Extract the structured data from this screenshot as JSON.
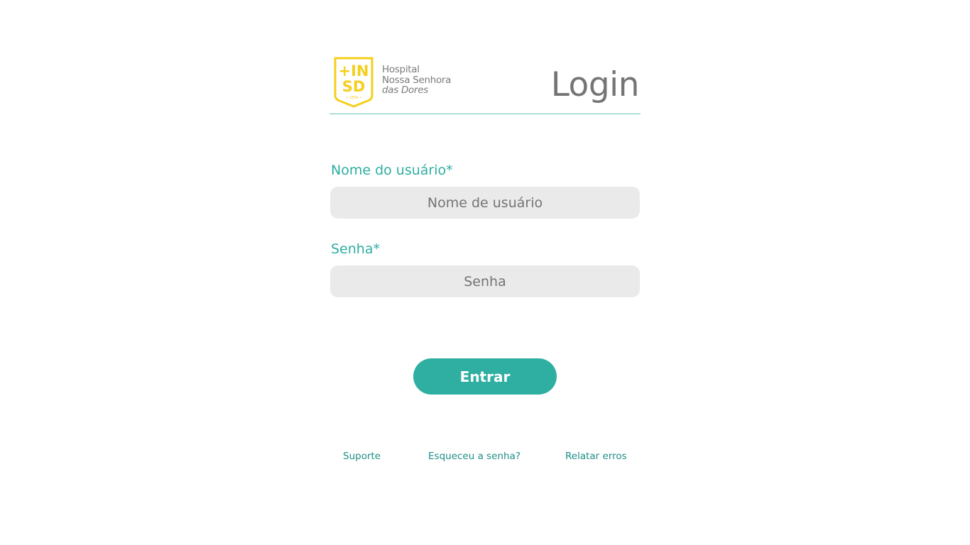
{
  "header": {
    "logo": {
      "monogram_top": "+INSD",
      "monogram_line1": "+IN",
      "monogram_line2": "SD",
      "year": "• 1859 •",
      "name_line1": "Hospital",
      "name_line2": "Nossa Senhora",
      "name_line3": "das Dores",
      "color": "#f5cf1e"
    },
    "title": "Login",
    "divider_color": "#6cc3bb"
  },
  "form": {
    "username": {
      "label": "Nome do usuário*",
      "placeholder": "Nome de usuário",
      "value": ""
    },
    "password": {
      "label": "Senha*",
      "placeholder": "Senha",
      "value": ""
    },
    "submit_label": "Entrar"
  },
  "footer": {
    "links": [
      {
        "label": "Suporte"
      },
      {
        "label": "Esqueceu a senha?"
      },
      {
        "label": "Relatar erros"
      }
    ]
  },
  "colors": {
    "accent": "#2fafa1",
    "label": "#2eaea0",
    "input_bg": "#eaeaea",
    "link": "#1f8f85",
    "title": "#757575"
  }
}
